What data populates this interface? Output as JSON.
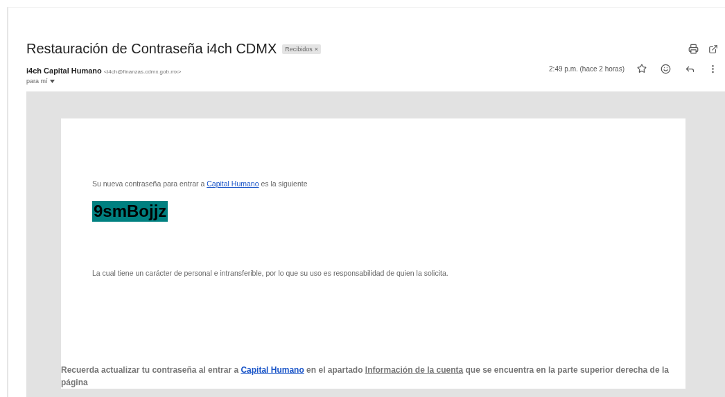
{
  "subject": "Restauración de Contraseña i4ch CDMX",
  "label": {
    "text": "Recibidos",
    "close": "×"
  },
  "sender": {
    "name": "i4ch Capital Humano",
    "email": "<i4ch@finanzas.cdmx.gob.mx>",
    "recipient": "para mí"
  },
  "time": "2:49 p.m. (hace 2 horas)",
  "body": {
    "intro": [
      {
        "kind": "text",
        "text": "Su nueva contraseña para entrar a "
      },
      {
        "kind": "link",
        "text": "Capital Humano"
      },
      {
        "kind": "text",
        "text": " es la siguiente"
      }
    ],
    "password": "9smBojjz",
    "note": "La cual tiene un carácter de personal e intransferible, por lo que su uso es responsabilidad de quien la solicita.",
    "reminder": [
      {
        "kind": "text",
        "text": "Recuerda actualizar tu contraseña al entrar a "
      },
      {
        "kind": "link",
        "text": "Capital Humano"
      },
      {
        "kind": "text",
        "text": " en el apartado "
      },
      {
        "kind": "underline",
        "text": "Información de la cuenta"
      },
      {
        "kind": "text",
        "text": " que se encuentra en la parte superior derecha de la página"
      }
    ]
  }
}
